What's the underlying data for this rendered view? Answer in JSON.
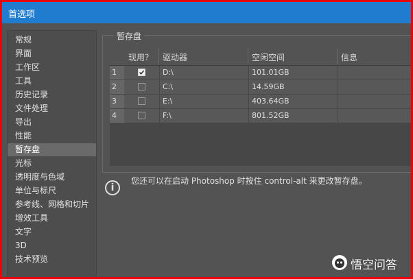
{
  "window": {
    "title": "首选项"
  },
  "sidebar": {
    "items": [
      {
        "label": "常规"
      },
      {
        "label": "界面"
      },
      {
        "label": "工作区"
      },
      {
        "label": "工具"
      },
      {
        "label": "历史记录"
      },
      {
        "label": "文件处理"
      },
      {
        "label": "导出"
      },
      {
        "label": "性能"
      },
      {
        "label": "暂存盘",
        "selected": true
      },
      {
        "label": "光标"
      },
      {
        "label": "透明度与色域"
      },
      {
        "label": "单位与标尺"
      },
      {
        "label": "参考线、网格和切片"
      },
      {
        "label": "增效工具"
      },
      {
        "label": "文字"
      },
      {
        "label": "3D"
      },
      {
        "label": "技术预览"
      }
    ]
  },
  "scratch": {
    "group_title": "暂存盘",
    "columns": {
      "active": "现用？",
      "drive": "驱动器",
      "free": "空闲空间",
      "info": "信息"
    },
    "rows": [
      {
        "index": "1",
        "checked": true,
        "drive": "D:\\",
        "free": "101.01GB",
        "info": ""
      },
      {
        "index": "2",
        "checked": false,
        "drive": "C:\\",
        "free": "14.59GB",
        "info": ""
      },
      {
        "index": "3",
        "checked": false,
        "drive": "E:\\",
        "free": "403.64GB",
        "info": ""
      },
      {
        "index": "4",
        "checked": false,
        "drive": "F:\\",
        "free": "801.52GB",
        "info": ""
      }
    ],
    "info_icon": "info-circle-icon",
    "info_text": "您还可以在启动 Photoshop 时按住 control-alt 来更改暂存盘。"
  },
  "watermark": {
    "text": "悟空问答",
    "icon": "wukong-logo-icon"
  },
  "colors": {
    "titlebar": "#1f7ccf",
    "panel": "#535353",
    "selected": "#6a6a6a",
    "border": "#e8050a"
  }
}
